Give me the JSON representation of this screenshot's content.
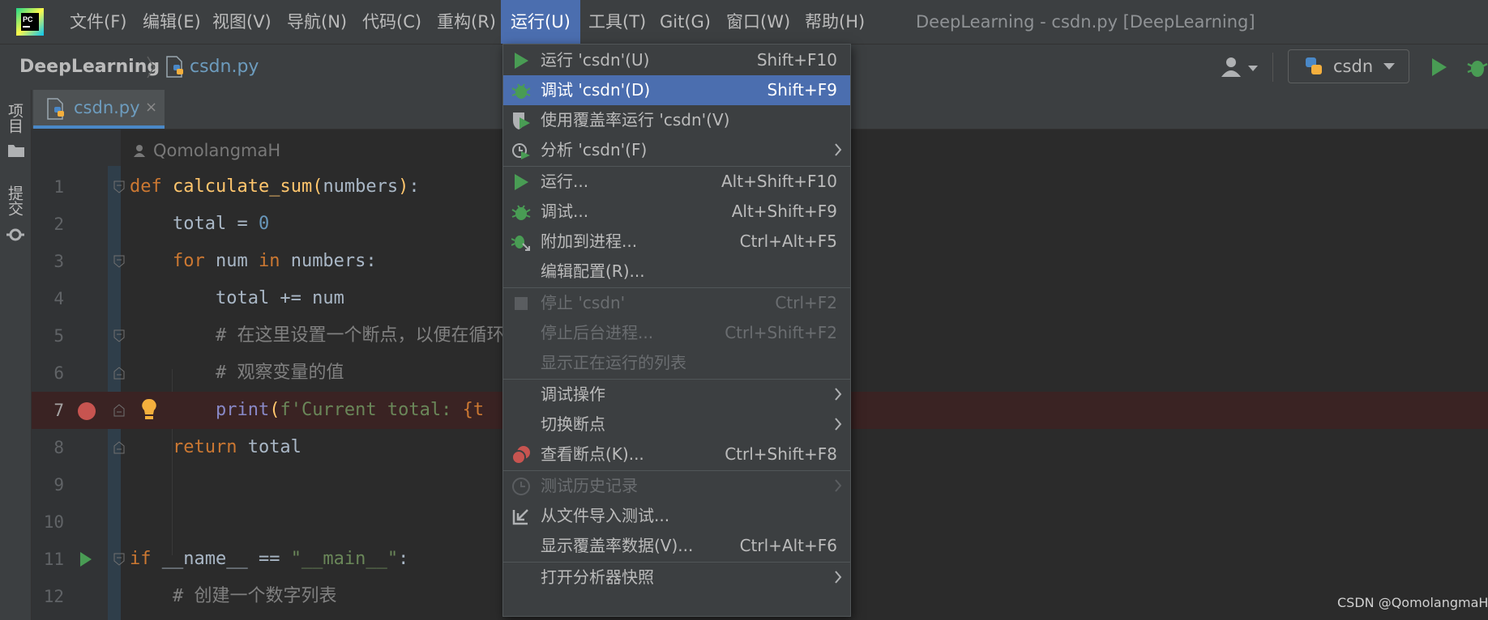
{
  "menubar": {
    "logo": "pycharm-logo-icon",
    "items": [
      "文件(F)",
      "编辑(E)",
      "视图(V)",
      "导航(N)",
      "代码(C)",
      "重构(R)",
      "运行(U)",
      "工具(T)",
      "Git(G)",
      "窗口(W)",
      "帮助(H)"
    ],
    "window_title": "DeepLearning - csdn.py [DeepLearning]"
  },
  "navbar": {
    "project": "DeepLearning",
    "file": "csdn.py",
    "run_config": "csdn"
  },
  "toolstrip": {
    "project_tab": "项目",
    "commit_tab": "提交"
  },
  "tabs": [
    {
      "label": "csdn.py",
      "close": "×"
    }
  ],
  "editor": {
    "author": "QomolangmaH",
    "line_numbers": [
      "1",
      "2",
      "3",
      "4",
      "5",
      "6",
      "7",
      "8",
      "9",
      "10",
      "11",
      "12"
    ],
    "code": {
      "l1_kw": "def",
      "l1_fn": "calculate_sum",
      "l1_p1": "(",
      "l1_arg": "numbers",
      "l1_p2": ")",
      "l1_end": ":",
      "l2_a": "    total = ",
      "l2_num": "0",
      "l3_kw": "    for",
      "l3_b": " num ",
      "l3_in": "in",
      "l3_c": " numbers:",
      "l4": "        total += num",
      "l5": "        # 在这里设置一个断点，以便在循环中",
      "l6": "        # 观察变量的值",
      "l7_pre": "        ",
      "l7_fn": "print",
      "l7_p": "(",
      "l7_str": "f'Current total: ",
      "l7_brace": "{t",
      "l8_kw": "    return",
      "l8_b": " total",
      "l11_kw": "if",
      "l11_b": " __name__ == ",
      "l11_str": "\"__main__\"",
      "l11_c": ":",
      "l12": "    # 创建一个数字列表"
    }
  },
  "run_menu": {
    "items": [
      {
        "label": "运行 'csdn'(U)",
        "shortcut": "Shift+F10",
        "icon": "run-icon"
      },
      {
        "label": "调试 'csdn'(D)",
        "shortcut": "Shift+F9",
        "icon": "debug-icon"
      },
      {
        "label": "使用覆盖率运行  'csdn'(V)",
        "shortcut": "",
        "icon": "coverage-icon"
      },
      {
        "label": "分析 'csdn'(F)",
        "shortcut": "",
        "icon": "profile-icon"
      },
      {
        "label": "运行...",
        "shortcut": "Alt+Shift+F10",
        "icon": "run-icon"
      },
      {
        "label": "调试...",
        "shortcut": "Alt+Shift+F9",
        "icon": "debug-icon"
      },
      {
        "label": "附加到进程...",
        "shortcut": "Ctrl+Alt+F5",
        "icon": "attach-debugger-icon"
      },
      {
        "label": "编辑配置(R)...",
        "shortcut": ""
      },
      {
        "label": "停止 'csdn'",
        "shortcut": "Ctrl+F2",
        "icon": "stop-icon"
      },
      {
        "label": "停止后台进程...",
        "shortcut": "Ctrl+Shift+F2"
      },
      {
        "label": "显示正在运行的列表",
        "shortcut": ""
      },
      {
        "label": "调试操作",
        "shortcut": ""
      },
      {
        "label": "切换断点",
        "shortcut": ""
      },
      {
        "label": "查看断点(K)...",
        "shortcut": "Ctrl+Shift+F8",
        "icon": "breakpoints-icon"
      },
      {
        "label": "测试历史记录",
        "shortcut": "",
        "icon": "history-icon"
      },
      {
        "label": "从文件导入测试...",
        "shortcut": "",
        "icon": "import-icon"
      },
      {
        "label": "显示覆盖率数据(V)...",
        "shortcut": "Ctrl+Alt+F6"
      },
      {
        "label": "打开分析器快照",
        "shortcut": ""
      }
    ]
  },
  "watermark": "CSDN @QomolangmaH",
  "colors": {
    "accent": "#4b6eaf",
    "run_green": "#499c54",
    "breakpoint_red": "#c75450"
  }
}
